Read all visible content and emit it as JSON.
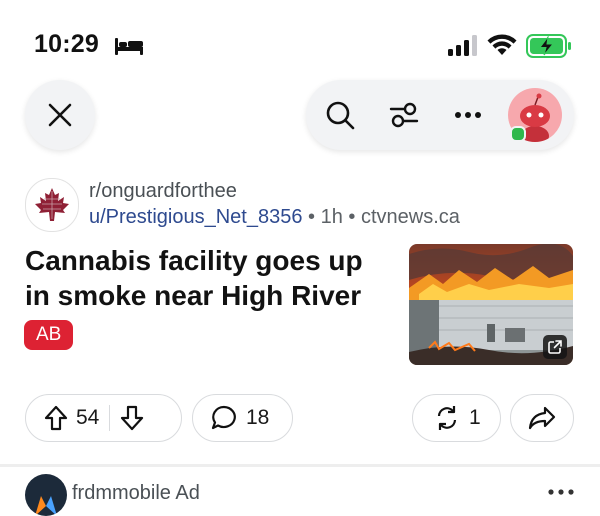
{
  "status_bar": {
    "time": "10:29",
    "accent_battery": "#34c759"
  },
  "post": {
    "subreddit": "r/onguardforthee",
    "author": "u/Prestigious_Net_8356",
    "sep1": " • ",
    "age": "1h",
    "sep2": " • ",
    "domain": "ctvnews.ca",
    "title": "Cannabis facility goes up in smoke near High River",
    "flair": "AB",
    "flair_color": "#dd2233",
    "upvotes": "54",
    "comments": "18",
    "shares": "1"
  },
  "next_post": {
    "name": "frdmmobile",
    "badge": "Ad"
  },
  "icons": [
    "close-icon",
    "search-icon",
    "filter-icon",
    "more-icon",
    "avatar",
    "upvote-icon",
    "downvote-icon",
    "comment-icon",
    "crosspost-icon",
    "share-icon",
    "external-link-icon"
  ]
}
